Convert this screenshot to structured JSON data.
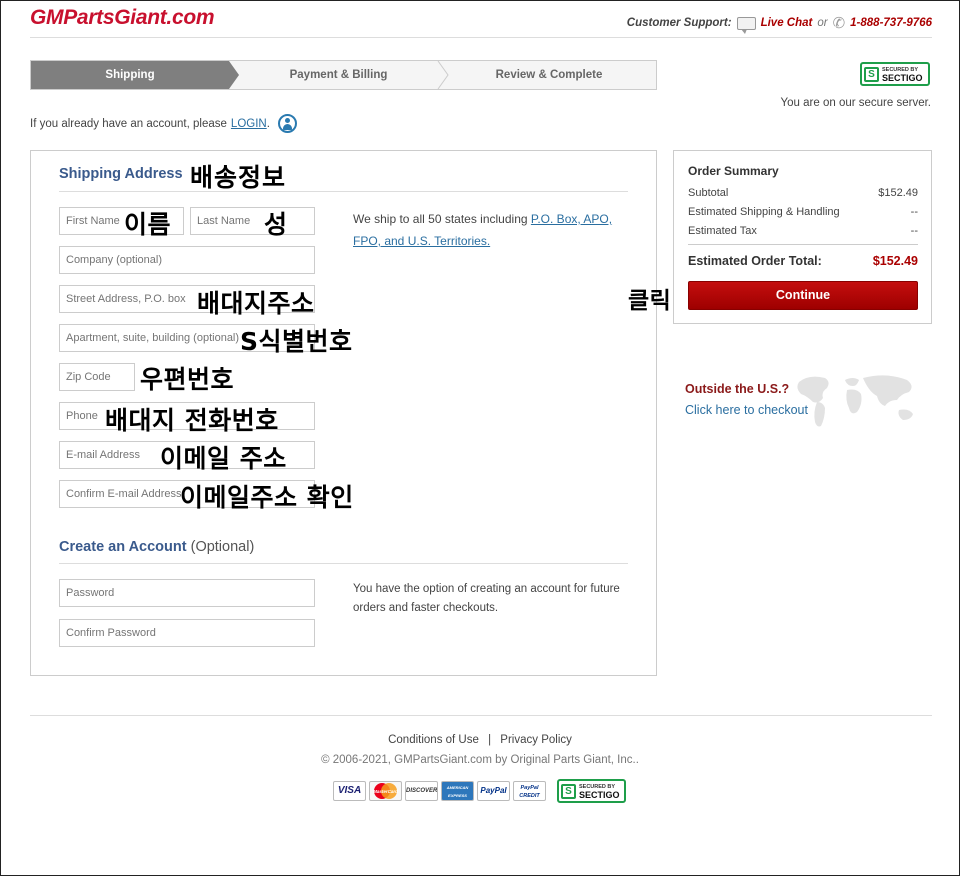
{
  "header": {
    "logo": "GMPartsGiant.com",
    "support_label": "Customer Support:",
    "live_chat": "Live Chat",
    "or": "or",
    "phone": "1-888-737-9766"
  },
  "steps": [
    "Shipping",
    "Payment & Billing",
    "Review & Complete"
  ],
  "security": {
    "badge_small": "SECURED BY",
    "badge_big": "SECTIGO",
    "secure_text": "You are on our secure server."
  },
  "login": {
    "prefix": "If you already have an account, please",
    "link": "LOGIN",
    "suffix": "."
  },
  "shipping": {
    "title": "Shipping Address",
    "title_note": "배송정보",
    "first_name": {
      "placeholder": "First Name",
      "note": "이름"
    },
    "last_name": {
      "placeholder": "Last Name",
      "note": "성"
    },
    "company": {
      "placeholder": "Company (optional)"
    },
    "street": {
      "placeholder": "Street Address, P.O. box",
      "note": "배대지주소"
    },
    "apartment": {
      "placeholder": "Apartment, suite, building (optional)",
      "note": "S식별번호"
    },
    "zip": {
      "placeholder": "Zip Code",
      "note": "우편번호"
    },
    "phone": {
      "placeholder": "Phone",
      "note": "배대지 전화번호"
    },
    "email": {
      "placeholder": "E-mail Address",
      "note": "이메일 주소"
    },
    "confirm_email": {
      "placeholder": "Confirm E-mail Address",
      "note": "이메일주소 확인"
    },
    "ship_note_prefix": "We ship to all 50 states including",
    "ship_note_link": "P.O. Box, APO, FPO, and U.S. Territories."
  },
  "account": {
    "title": "Create an Account",
    "title_opt": "(Optional)",
    "password": {
      "placeholder": "Password"
    },
    "confirm_password": {
      "placeholder": "Confirm Password"
    },
    "note": "You have the option of creating an account for future orders and faster checkouts."
  },
  "summary": {
    "title": "Order Summary",
    "rows": [
      {
        "label": "Subtotal",
        "value": "$152.49"
      },
      {
        "label": "Estimated Shipping & Handling",
        "value": "--"
      },
      {
        "label": "Estimated Tax",
        "value": "--"
      }
    ],
    "total_label": "Estimated Order Total:",
    "total_value": "$152.49",
    "continue": "Continue",
    "click_note": "클릭"
  },
  "outside": {
    "title": "Outside the U.S.?",
    "link": "Click here to checkout"
  },
  "footer": {
    "conditions": "Conditions of Use",
    "separator": "|",
    "privacy": "Privacy Policy",
    "copyright": "© 2006-2021, GMPartsGiant.com by Original Parts Giant, Inc..",
    "cards": [
      "VISA",
      "MasterCard",
      "DISCOVER",
      "AMERICAN EXPRESS",
      "PayPal",
      "PayPal CREDIT"
    ]
  }
}
